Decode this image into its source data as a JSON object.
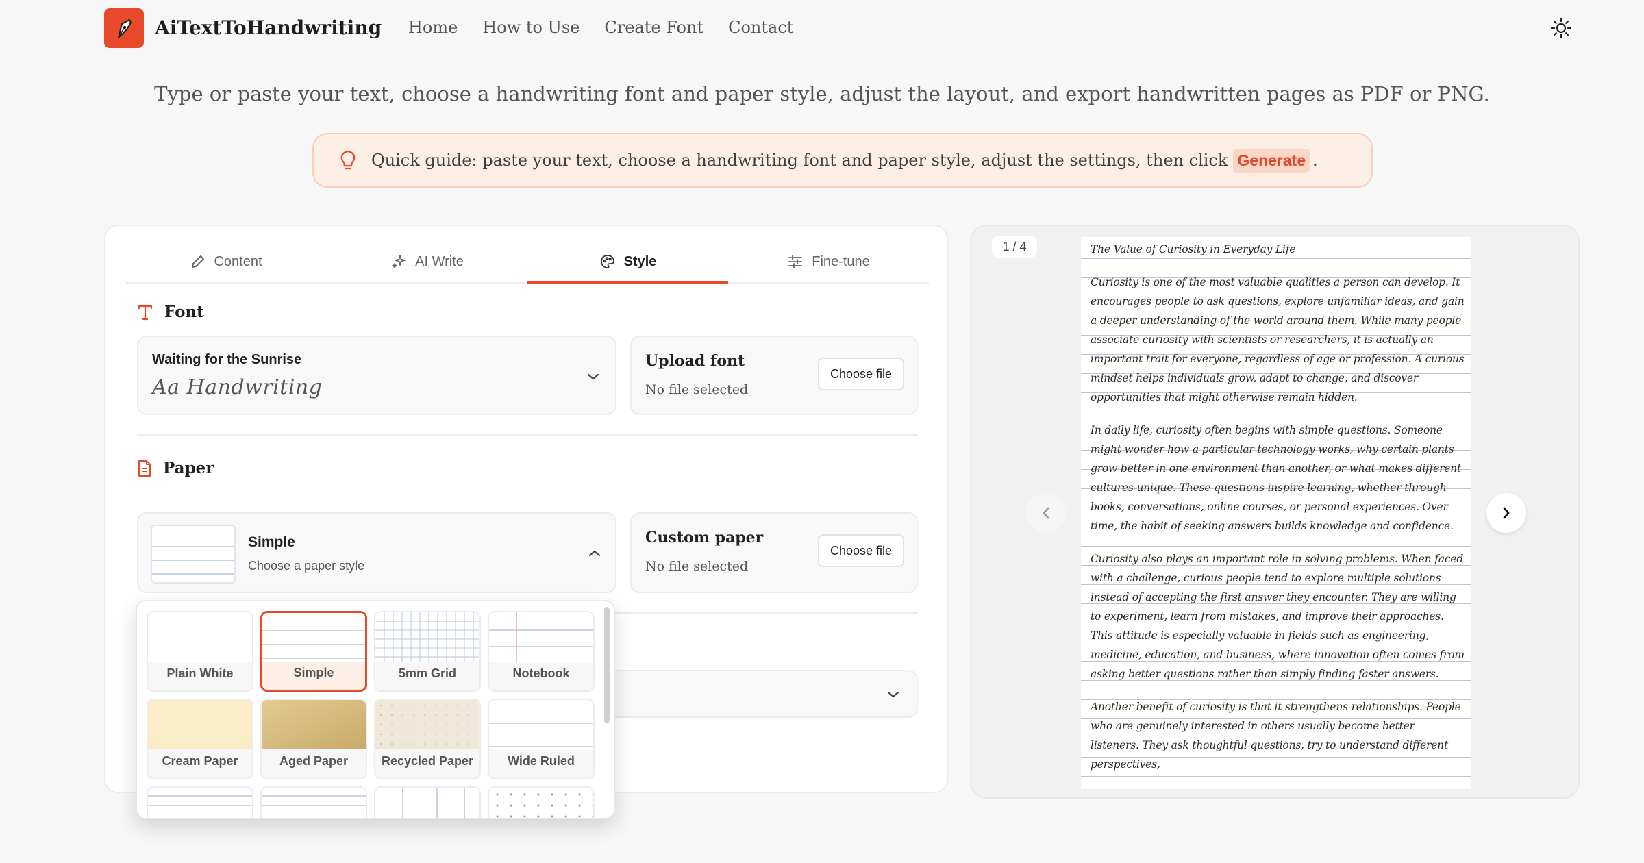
{
  "brand": {
    "name": "AiTextToHandwriting"
  },
  "nav": {
    "links": [
      "Home",
      "How to Use",
      "Create Font",
      "Contact"
    ]
  },
  "hero": {
    "subtitle": "Type or paste your text, choose a handwriting font and paper style, adjust the layout, and export handwritten pages as PDF or PNG.",
    "guide_text": "Quick guide: paste your text, choose a handwriting font and paper style, adjust the settings, then click",
    "guide_highlight": "Generate",
    "guide_end": "."
  },
  "tabs": [
    {
      "label": "Content",
      "icon": "pencil-icon"
    },
    {
      "label": "AI Write",
      "icon": "sparkle-icon"
    },
    {
      "label": "Style",
      "icon": "palette-icon",
      "active": true
    },
    {
      "label": "Fine-tune",
      "icon": "sliders-icon"
    }
  ],
  "font_section": {
    "title": "Font",
    "selected_font": "Waiting for the Sunrise",
    "preview": "Aa Handwriting",
    "upload_title": "Upload font",
    "upload_button": "Choose file",
    "upload_status": "No file selected"
  },
  "paper_section": {
    "title": "Paper",
    "selected": "Simple",
    "hint": "Choose a paper style",
    "custom_title": "Custom paper",
    "custom_button": "Choose file",
    "custom_status": "No file selected"
  },
  "paper_options": [
    {
      "label": "Plain White",
      "swatch": "plain"
    },
    {
      "label": "Simple",
      "swatch": "simple",
      "selected": true
    },
    {
      "label": "5mm Grid",
      "swatch": "grid"
    },
    {
      "label": "Notebook",
      "swatch": "notebook"
    },
    {
      "label": "Cream Paper",
      "swatch": "cream"
    },
    {
      "label": "Aged Paper",
      "swatch": "aged"
    },
    {
      "label": "Recycled Paper",
      "swatch": "recycled"
    },
    {
      "label": "Wide Ruled",
      "swatch": "wide"
    },
    {
      "label": "",
      "swatch": "lined2"
    },
    {
      "label": "",
      "swatch": "lined3"
    },
    {
      "label": "",
      "swatch": "cols"
    },
    {
      "label": "",
      "swatch": "dots"
    }
  ],
  "preview": {
    "page_indicator": "1 / 4",
    "title": "The Value of Curiosity in Everyday Life",
    "paragraphs": [
      "Curiosity is one of the most valuable qualities a person can develop. It encourages people to ask questions, explore unfamiliar ideas, and gain a deeper understanding of the world around them. While many people associate curiosity with scientists or researchers, it is actually an important trait for everyone, regardless of age or profession. A curious mindset helps individuals grow, adapt to change, and discover opportunities that might otherwise remain hidden.",
      "In daily life, curiosity often begins with simple questions. Someone might wonder how a particular technology works, why certain plants grow better in one environment than another, or what makes different cultures unique. These questions inspire learning, whether through books, conversations, online courses, or personal experiences. Over time, the habit of seeking answers builds knowledge and confidence.",
      "Curiosity also plays an important role in solving problems. When faced with a challenge, curious people tend to explore multiple solutions instead of accepting the first answer they encounter. They are willing to experiment, learn from mistakes, and improve their approaches. This attitude is especially valuable in fields such as engineering, medicine, education, and business, where innovation often comes from asking better questions rather than simply finding faster answers.",
      "Another benefit of curiosity is that it strengthens relationships. People who are genuinely interested in others usually become better listeners. They ask thoughtful questions, try to understand different perspectives,"
    ]
  },
  "colors": {
    "accent": "#e8492a",
    "guide_bg": "#fdeee6",
    "guide_border": "#f8cdb9"
  }
}
